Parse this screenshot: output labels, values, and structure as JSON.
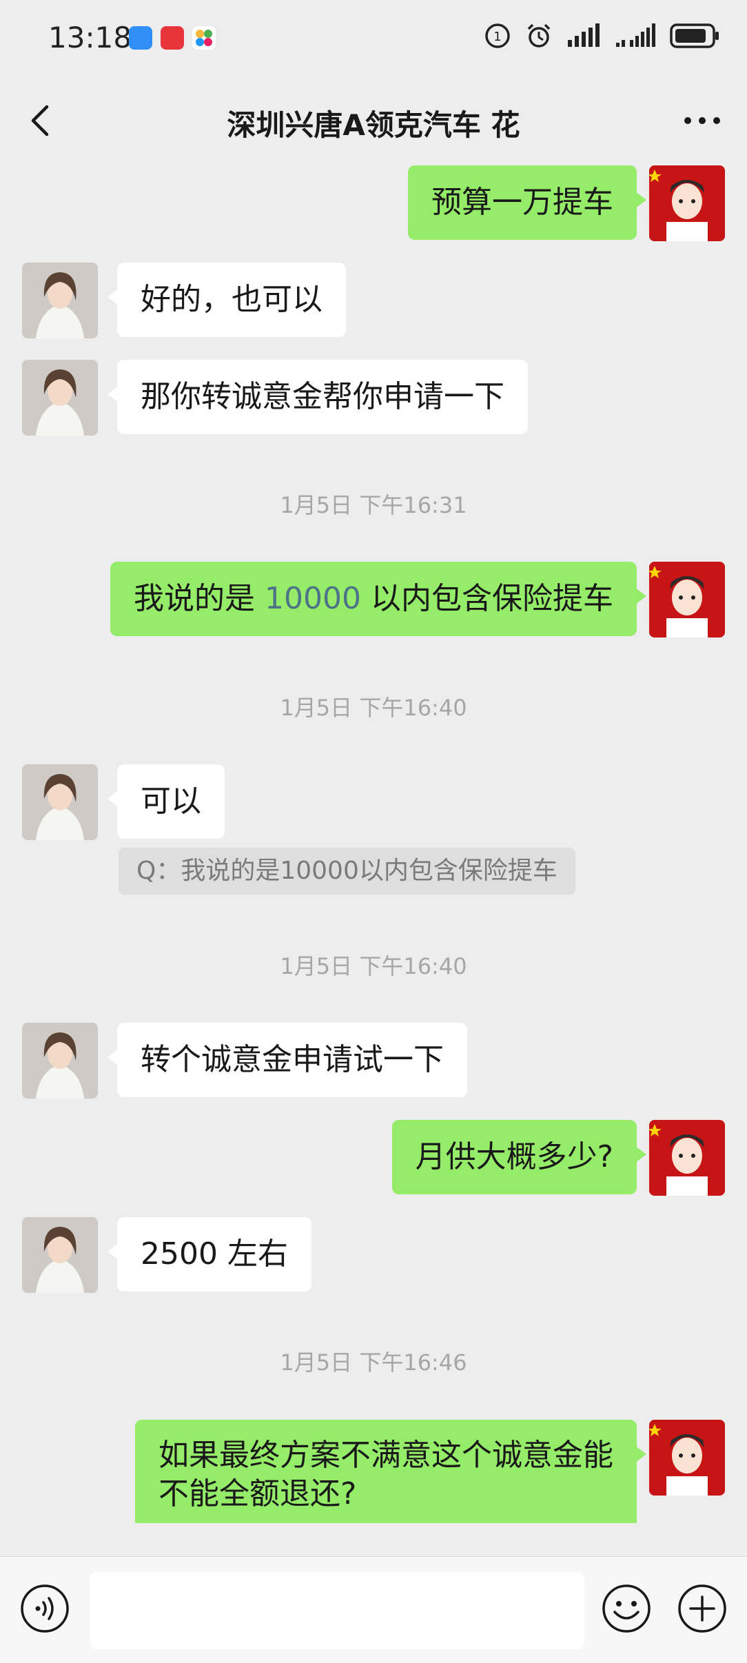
{
  "status_bar": {
    "time": "13:18"
  },
  "header": {
    "title": "深圳兴唐A领克汽车 花"
  },
  "messages": {
    "m1": {
      "text": "预算一万提车"
    },
    "m2": {
      "text": "好的，也可以"
    },
    "m3": {
      "text": "那你转诚意金帮你申请一下"
    },
    "ts1": "1月5日 下午16:31",
    "m4": {
      "pre": "我说的是 ",
      "num": "10000",
      "post": " 以内包含保险提车"
    },
    "ts2": "1月5日 下午16:40",
    "m5": {
      "text": "可以",
      "quote": "Q：我说的是10000以内包含保险提车"
    },
    "ts3": "1月5日 下午16:40",
    "m6": {
      "text": "转个诚意金申请试一下"
    },
    "m7": {
      "text": "月供大概多少?"
    },
    "m8": {
      "text": "2500 左右"
    },
    "ts4": "1月5日 下午16:46",
    "m9": {
      "line1": "如果最终方案不满意这个诚意金能",
      "line2": "不能全额退还?"
    }
  },
  "colors": {
    "sent_bubble": "#95ec69",
    "received_bubble": "#ffffff",
    "background": "#ededed",
    "number_link": "#4e7388"
  },
  "icons": [
    "back-arrow-icon",
    "more-icon",
    "voice-icon",
    "emoji-icon",
    "plus-icon"
  ]
}
